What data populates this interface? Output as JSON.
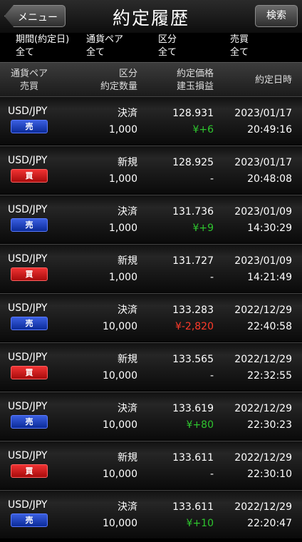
{
  "header": {
    "title": "約定履歴",
    "menu_label": "メニュー",
    "search_label": "検索"
  },
  "filters": [
    {
      "label": "期間(約定日)",
      "value": "全て"
    },
    {
      "label": "通貨ペア",
      "value": "全て"
    },
    {
      "label": "区分",
      "value": "全て"
    },
    {
      "label": "売買",
      "value": "全て"
    }
  ],
  "columns": {
    "pair": "通貨ペア",
    "side": "売買",
    "kind": "区分",
    "qty": "約定数量",
    "price": "約定価格",
    "pl": "建玉損益",
    "datetime": "約定日時"
  },
  "colors": {
    "profit": "#2ec52e",
    "loss": "#ff3a2a",
    "neutral": "#ffffff",
    "sell": "#1a3fcc",
    "buy": "#d81c1c"
  },
  "trades": [
    {
      "pair": "USD/JPY",
      "side": "売",
      "kind": "決済",
      "qty": "1,000",
      "price": "128.931",
      "pl": "¥+6",
      "pl_type": "profit",
      "date": "2023/01/17",
      "time": "20:49:16"
    },
    {
      "pair": "USD/JPY",
      "side": "買",
      "kind": "新規",
      "qty": "1,000",
      "price": "128.925",
      "pl": "-",
      "pl_type": "neutral",
      "date": "2023/01/17",
      "time": "20:48:08"
    },
    {
      "pair": "USD/JPY",
      "side": "売",
      "kind": "決済",
      "qty": "1,000",
      "price": "131.736",
      "pl": "¥+9",
      "pl_type": "profit",
      "date": "2023/01/09",
      "time": "14:30:29"
    },
    {
      "pair": "USD/JPY",
      "side": "買",
      "kind": "新規",
      "qty": "1,000",
      "price": "131.727",
      "pl": "-",
      "pl_type": "neutral",
      "date": "2023/01/09",
      "time": "14:21:49"
    },
    {
      "pair": "USD/JPY",
      "side": "売",
      "kind": "決済",
      "qty": "10,000",
      "price": "133.283",
      "pl": "¥-2,820",
      "pl_type": "loss",
      "date": "2022/12/29",
      "time": "22:40:58"
    },
    {
      "pair": "USD/JPY",
      "side": "買",
      "kind": "新規",
      "qty": "10,000",
      "price": "133.565",
      "pl": "-",
      "pl_type": "neutral",
      "date": "2022/12/29",
      "time": "22:32:55"
    },
    {
      "pair": "USD/JPY",
      "side": "売",
      "kind": "決済",
      "qty": "10,000",
      "price": "133.619",
      "pl": "¥+80",
      "pl_type": "profit",
      "date": "2022/12/29",
      "time": "22:30:23"
    },
    {
      "pair": "USD/JPY",
      "side": "買",
      "kind": "新規",
      "qty": "10,000",
      "price": "133.611",
      "pl": "-",
      "pl_type": "neutral",
      "date": "2022/12/29",
      "time": "22:30:10"
    },
    {
      "pair": "USD/JPY",
      "side": "売",
      "kind": "決済",
      "qty": "10,000",
      "price": "133.611",
      "pl": "¥+10",
      "pl_type": "profit",
      "date": "2022/12/29",
      "time": "22:20:47"
    }
  ]
}
